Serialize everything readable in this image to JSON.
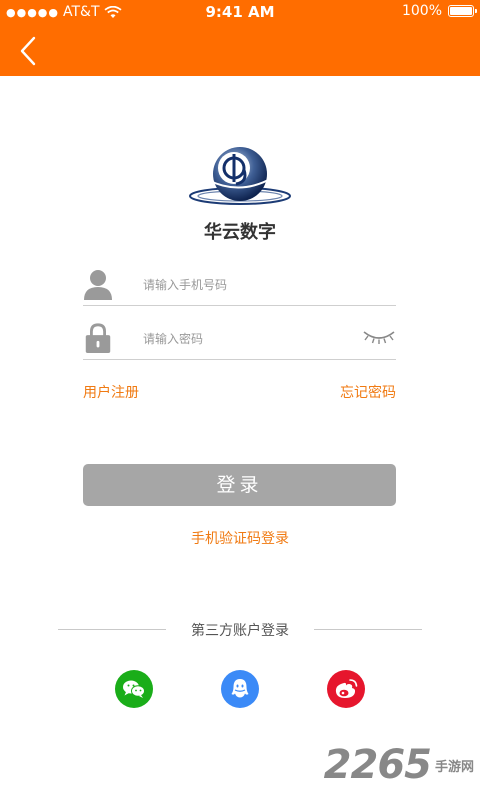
{
  "status_bar": {
    "signal_dots": "●●●●●",
    "carrier": "AT&T",
    "time": "9:41 AM",
    "battery": "100%"
  },
  "nav": {
    "back_icon": "chevron-left-icon"
  },
  "brand": {
    "name": "华云数字"
  },
  "form": {
    "phone_placeholder": "请输入手机号码",
    "password_placeholder": "请输入密码",
    "register_label": "用户注册",
    "forgot_label": "忘记密码",
    "login_label": "登录",
    "sms_login_label": "手机验证码登录"
  },
  "third_party": {
    "title": "第三方账户登录",
    "providers": [
      {
        "name": "wechat",
        "icon": "wechat-icon",
        "color": "#1aad19"
      },
      {
        "name": "qq",
        "icon": "qq-icon",
        "color": "#3b8af7"
      },
      {
        "name": "weibo",
        "icon": "weibo-icon",
        "color": "#e6162d"
      }
    ]
  },
  "watermark": {
    "number": "2265",
    "text": "手游网"
  },
  "colors": {
    "accent": "#ff6d00",
    "link": "#f07a12",
    "button_disabled": "#a6a6a6"
  }
}
